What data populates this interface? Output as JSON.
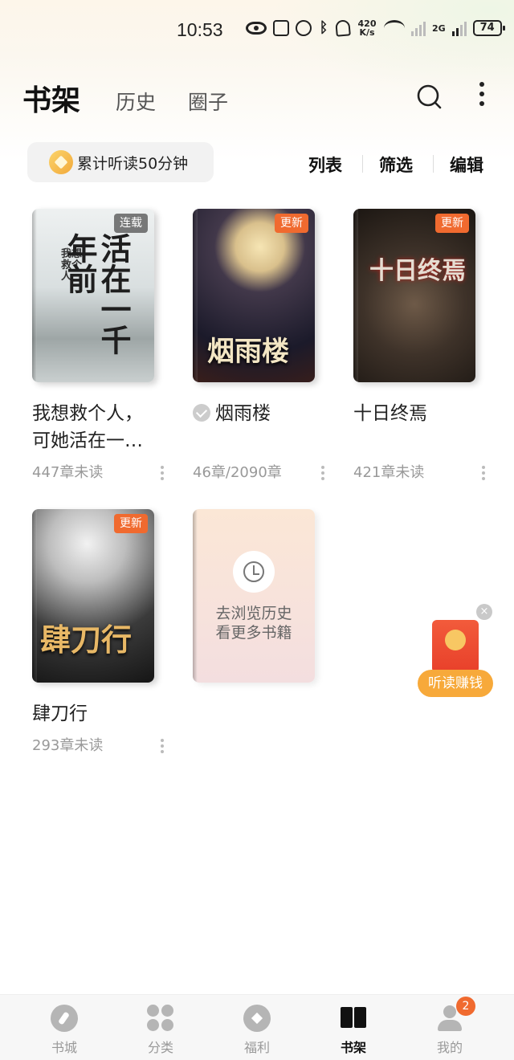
{
  "status_bar": {
    "time": "10:53",
    "net_speed_value": "420",
    "net_speed_unit": "K/s",
    "network_type": "2G",
    "battery": "74"
  },
  "header": {
    "tabs": [
      {
        "label": "书架",
        "active": true
      },
      {
        "label": "历史",
        "active": false
      },
      {
        "label": "圈子",
        "active": false
      }
    ],
    "icons": [
      "search-icon",
      "more-vertical-icon"
    ]
  },
  "toolbar": {
    "listen_label": "累计听读50分钟",
    "list_label": "列表",
    "filter_label": "筛选",
    "edit_label": "编辑"
  },
  "books": [
    {
      "cover_title": "活在一千年前",
      "cover_subtitle": "我想救个人",
      "badge": "连载",
      "title": "我想救个人，可她活在一…",
      "progress": "447章未读"
    },
    {
      "cover_title": "烟雨楼",
      "cover_subtitle": "",
      "badge": "更新",
      "title": "烟雨楼",
      "progress": "46章/2090章",
      "finished": true
    },
    {
      "cover_title": "十日终焉",
      "cover_subtitle": "",
      "badge": "更新",
      "title": "十日终焉",
      "progress": "421章未读"
    },
    {
      "cover_title": "肆刀行",
      "cover_subtitle": "",
      "badge": "更新",
      "title": "肆刀行",
      "progress": "293章未读"
    }
  ],
  "browse_card": {
    "line1": "去浏览历史",
    "line2": "看更多书籍"
  },
  "floating_reward": {
    "label": "听读赚钱",
    "close": "×"
  },
  "bottom_nav": {
    "items": [
      {
        "label": "书城",
        "icon": "compass-icon"
      },
      {
        "label": "分类",
        "icon": "category-grid-icon"
      },
      {
        "label": "福利",
        "icon": "gift-icon"
      },
      {
        "label": "书架",
        "icon": "bookshelf-icon",
        "active": true
      },
      {
        "label": "我的",
        "icon": "user-icon",
        "badge": "2"
      }
    ]
  },
  "colors": {
    "accent": "#f06a2f",
    "update_badge": "#f06a2f",
    "reward_orange": "#f7a93a"
  }
}
